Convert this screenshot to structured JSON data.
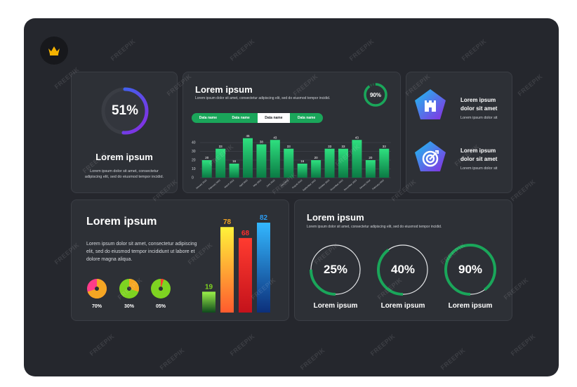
{
  "colors": {
    "background": "#25272d",
    "panel": "#2d3036",
    "green": "#1aa65a",
    "blue": "#2b6ff0",
    "purple": "#8a2be2"
  },
  "logo": {
    "icon": "crown-icon"
  },
  "gauge_card": {
    "value_label": "51%",
    "value": 51,
    "title": "Lorem ipsum",
    "description": "Lorem ipsum dolor sit amet, consectetur adipiscing elit, sed do eiusmod tempor incidid."
  },
  "chart_card": {
    "title": "Lorem ipsum",
    "description": "Lorem ipsum dolor sit amet, consectetur adipiscing elit, sed do eiusmod tempor incidid.",
    "ring_label": "90%",
    "ring_value": 90,
    "tabs": [
      "Data name",
      "Data name",
      "Data name",
      "Data name"
    ],
    "active_tab": 2
  },
  "chart_data": {
    "type": "bar",
    "categories": [
      "January 2023",
      "February 2023",
      "March 2023",
      "April 2023",
      "May 2023",
      "June 2023",
      "July 2023",
      "August 2023",
      "September 2023",
      "October 2023",
      "November 2023",
      "December 2023",
      "January 2024",
      "February 2024"
    ],
    "values": [
      20,
      33,
      16,
      45,
      38,
      43,
      33,
      16,
      20,
      33,
      33,
      43,
      20,
      33
    ],
    "value_labels": [
      "20",
      "33",
      "16",
      "45",
      "38",
      "43",
      "33",
      "16",
      "20",
      "33",
      "33",
      "43",
      "20",
      "33"
    ],
    "yticks": [
      "0",
      "10",
      "20",
      "30",
      "40"
    ],
    "ylim": [
      0,
      48
    ],
    "grid": true
  },
  "icon_card": {
    "items": [
      {
        "icon": "castle-icon",
        "title": "Lorem ipsum dolor sit amet",
        "subtitle": "Lorem ipsum dolor sit"
      },
      {
        "icon": "target-icon",
        "title": "Lorem ipsum dolor sit amet",
        "subtitle": "Lorem ipsum dolor sit"
      }
    ]
  },
  "bars_card": {
    "title": "Lorem ipsum",
    "description": "Lorem ipsum dolor sit amet, consectetur adipiscing elit, sed do eiusmod tempor incididunt ut labore et dolore magna aliqua.",
    "pies": [
      {
        "label": "70%",
        "value": 70
      },
      {
        "label": "30%",
        "value": 30
      },
      {
        "label": "05%",
        "value": 5
      }
    ],
    "bars": [
      {
        "label": "19",
        "value": 19,
        "color": "#7ed321"
      },
      {
        "label": "78",
        "value": 78,
        "color": "#f5a623"
      },
      {
        "label": "68",
        "value": 68,
        "color": "#ff2d2d"
      },
      {
        "label": "82",
        "value": 82,
        "color": "#2b9bf0"
      }
    ]
  },
  "rings_card": {
    "title": "Lorem ipsum",
    "description": "Lorem ipsum dolor sit amet, consectetur adipiscing elit, sed do eiusmod tempor incidid.",
    "rings": [
      {
        "value_label": "25%",
        "value": 25,
        "label": "Lorem ipsum"
      },
      {
        "value_label": "40%",
        "value": 40,
        "label": "Lorem ipsum"
      },
      {
        "value_label": "90%",
        "value": 90,
        "label": "Lorem ipsum"
      }
    ]
  },
  "watermark": "FREEPIK"
}
